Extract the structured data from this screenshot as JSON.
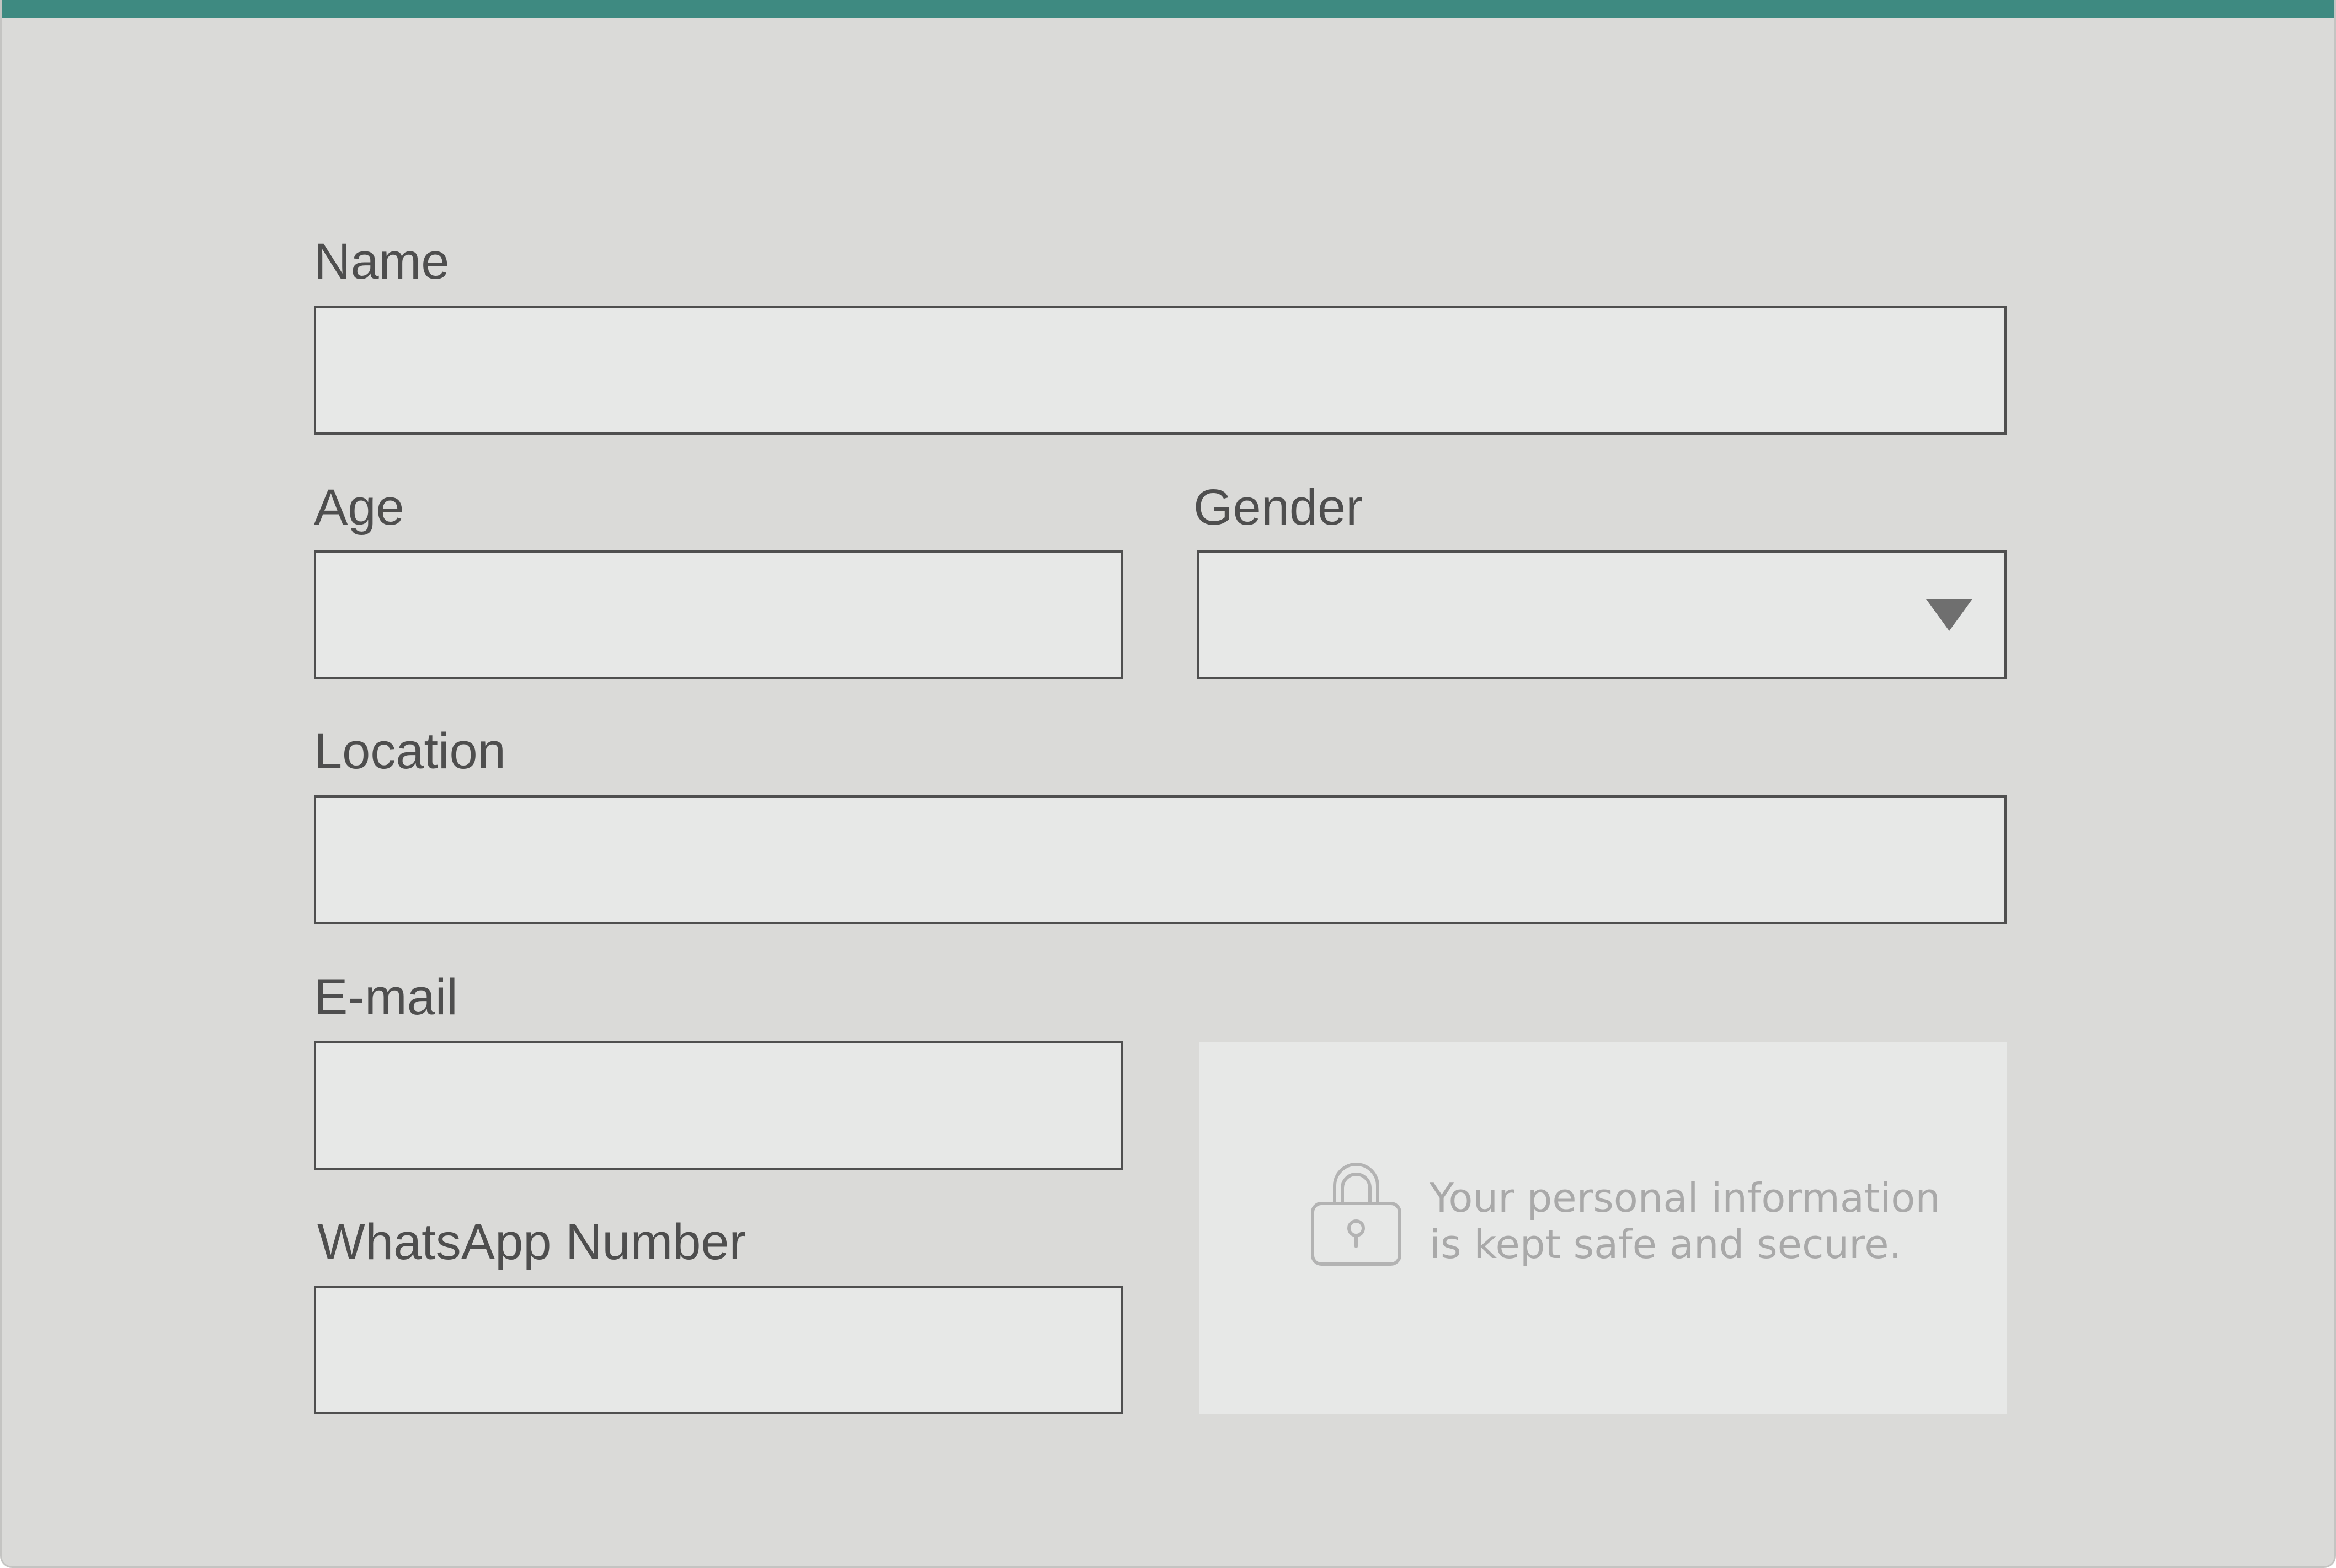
{
  "form": {
    "name": {
      "label": "Name",
      "value": "",
      "placeholder": ""
    },
    "age": {
      "label": "Age",
      "value": "",
      "placeholder": ""
    },
    "gender": {
      "label": "Gender",
      "selected": ""
    },
    "location": {
      "label": "Location",
      "value": "",
      "placeholder": ""
    },
    "email": {
      "label": "E-mail",
      "value": "",
      "placeholder": ""
    },
    "whatsapp": {
      "label": "WhatsApp Number",
      "value": "",
      "placeholder": ""
    }
  },
  "security_note": {
    "line1": "Your personal information",
    "line2": "is kept safe and secure.",
    "icon": "lock-icon"
  },
  "colors": {
    "accent": "#3e8a81",
    "background": "#dadad8",
    "field_background": "#e7e8e7",
    "field_border": "#4f4f4f",
    "label_text": "#4e4e4e",
    "muted_text": "#a9a9a9"
  }
}
